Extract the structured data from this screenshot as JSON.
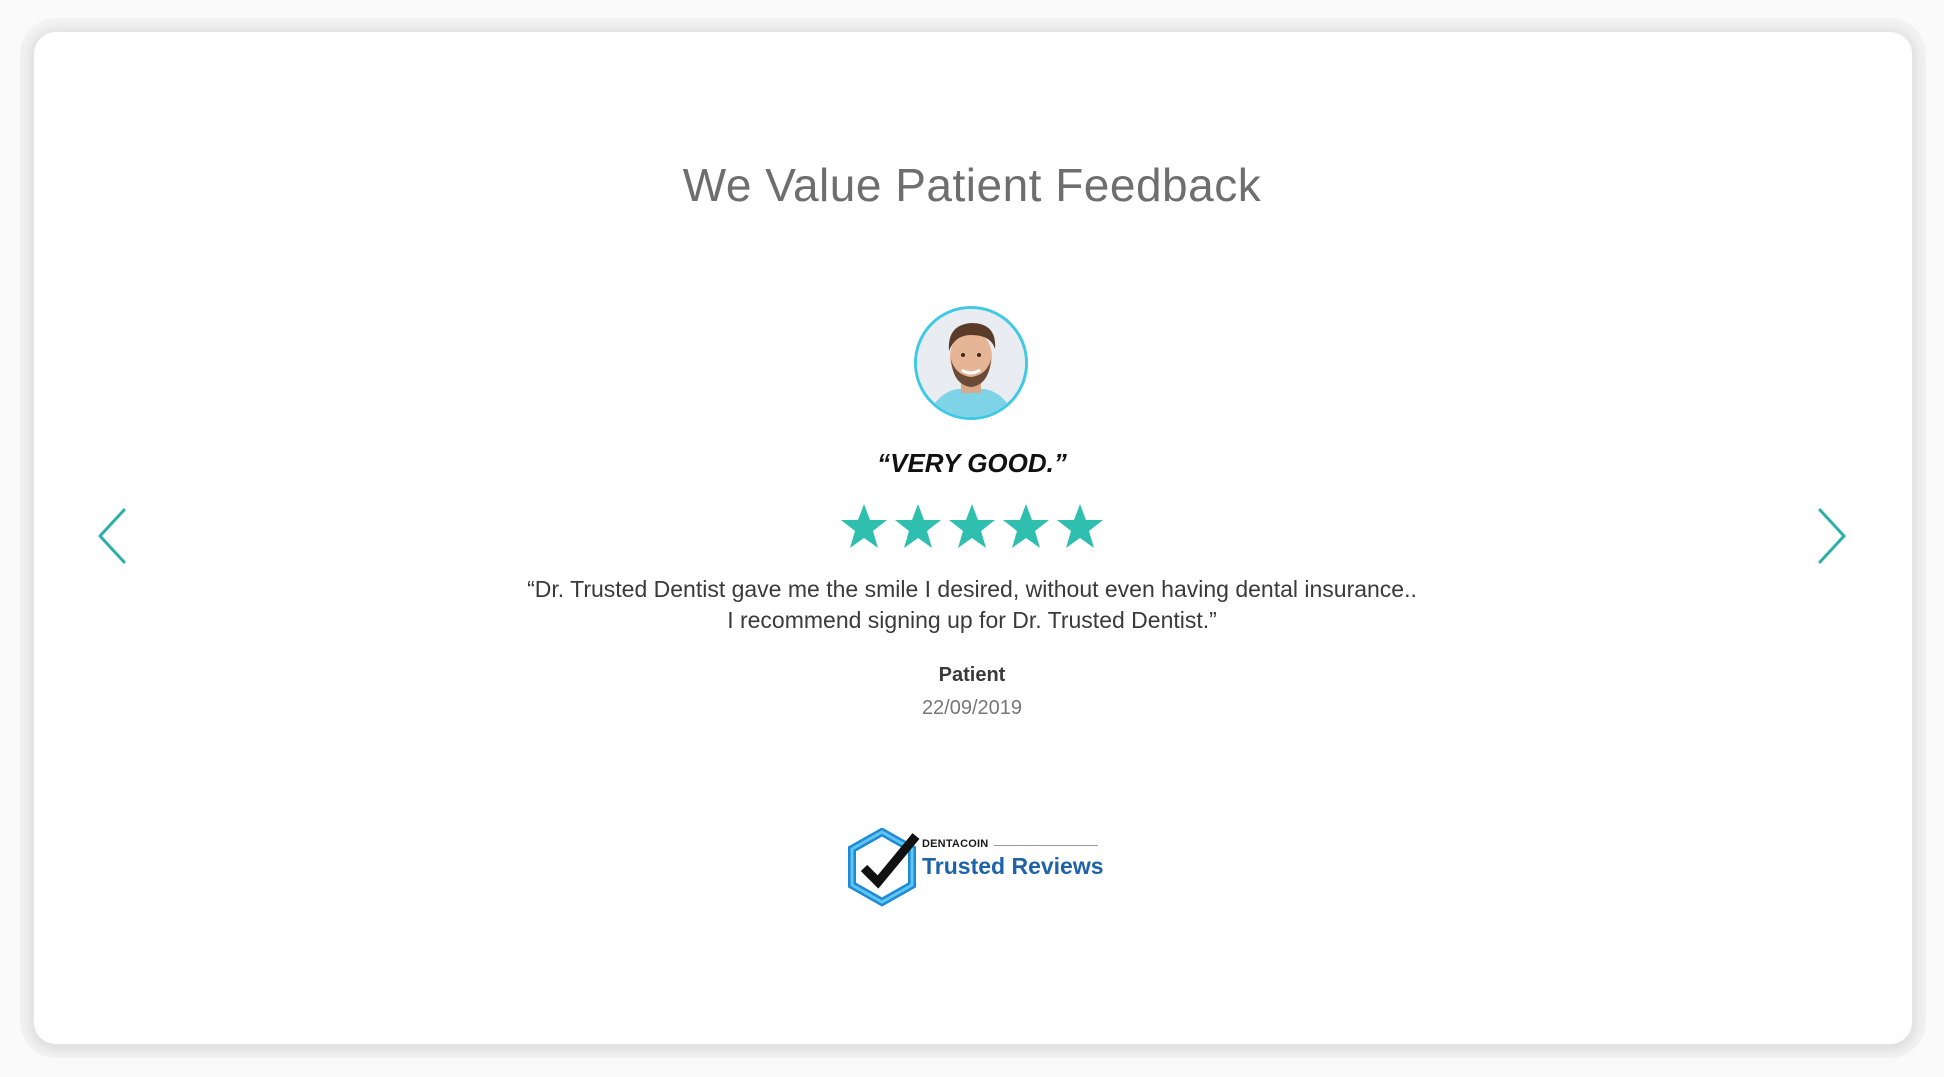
{
  "section": {
    "title": "We Value Patient Feedback"
  },
  "review": {
    "headline": "“VERY GOOD.”",
    "rating": 5,
    "rating_max": 5,
    "text_line1": "“Dr. Trusted Dentist gave me the smile I desired, without even having dental insurance..",
    "text_line2": "I recommend signing up for Dr. Trusted Dentist.”",
    "author": "Patient",
    "date": "22/09/2019"
  },
  "navigation": {
    "prev_icon": "chevron-left-icon",
    "next_icon": "chevron-right-icon"
  },
  "brand": {
    "top_label": "DENTACOIN",
    "main_label": "Trusted Reviews"
  },
  "colors": {
    "star": "#2ebfae",
    "arrow": "#2ab0a4",
    "avatar_ring": "#3ec9e6",
    "brand_blue": "#1e63a8",
    "title": "#6e6e6e"
  }
}
